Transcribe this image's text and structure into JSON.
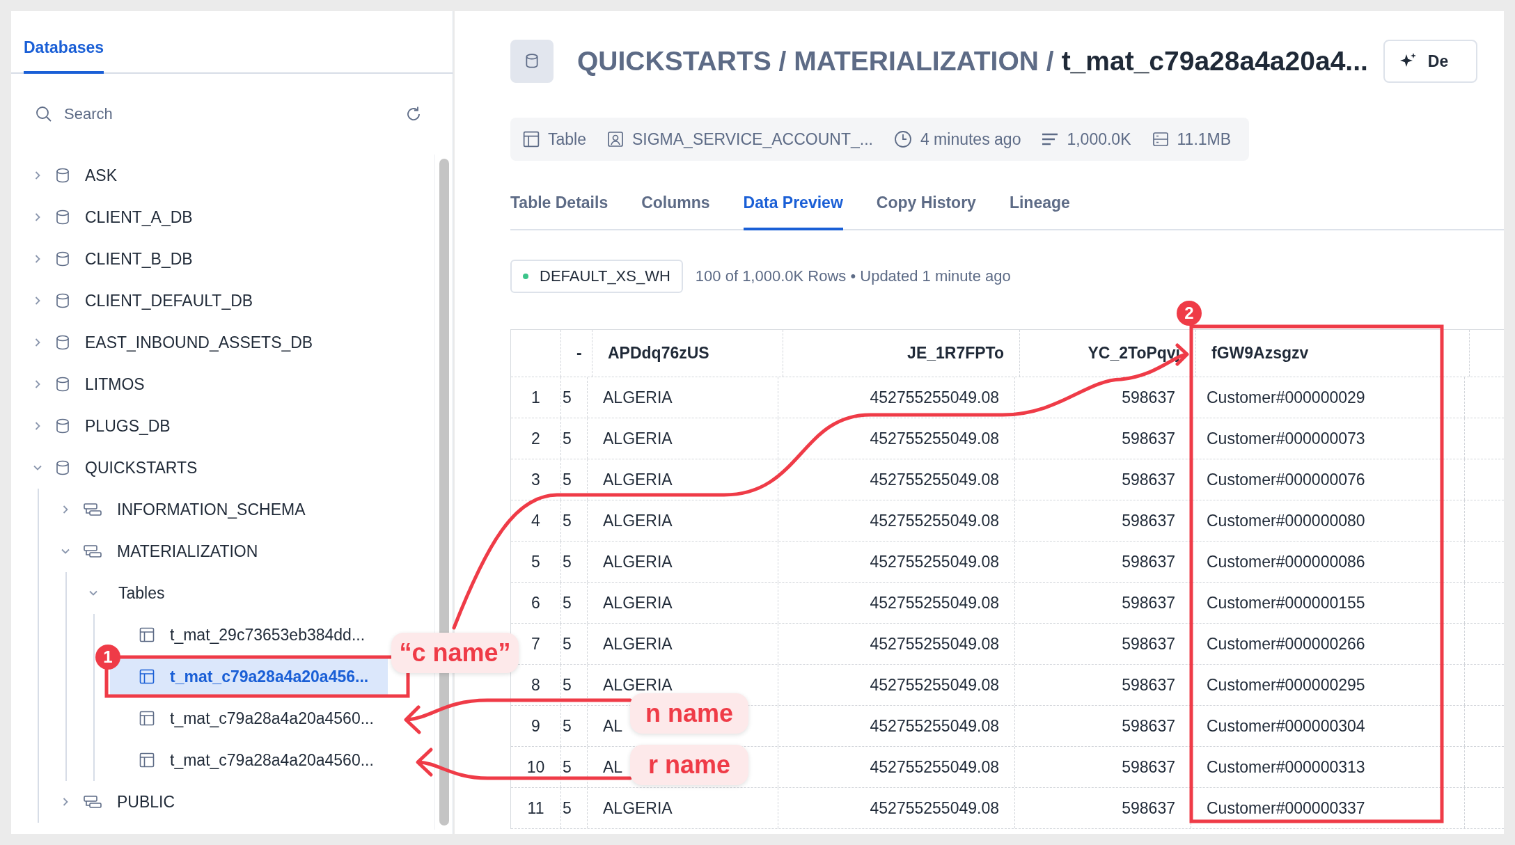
{
  "sidebar": {
    "tab": {
      "label": "Databases",
      "selected": true
    },
    "search": {
      "placeholder": "Search"
    },
    "tree": [
      {
        "kind": "database",
        "label": "ASK",
        "expanded": false,
        "selected": false
      },
      {
        "kind": "database",
        "label": "CLIENT_A_DB",
        "expanded": false,
        "selected": false
      },
      {
        "kind": "database",
        "label": "CLIENT_B_DB",
        "expanded": false,
        "selected": false
      },
      {
        "kind": "database",
        "label": "CLIENT_DEFAULT_DB",
        "expanded": false,
        "selected": false
      },
      {
        "kind": "database",
        "label": "EAST_INBOUND_ASSETS_DB",
        "expanded": false,
        "selected": false
      },
      {
        "kind": "database",
        "label": "LITMOS",
        "expanded": false,
        "selected": false
      },
      {
        "kind": "database",
        "label": "PLUGS_DB",
        "expanded": false,
        "selected": false
      },
      {
        "kind": "database",
        "label": "QUICKSTARTS",
        "expanded": true,
        "selected": false,
        "children": [
          {
            "kind": "schema",
            "label": "INFORMATION_SCHEMA",
            "expanded": false,
            "selected": false
          },
          {
            "kind": "schema",
            "label": "MATERIALIZATION",
            "expanded": true,
            "selected": false,
            "children": [
              {
                "kind": "folder",
                "label": "Tables",
                "expanded": true,
                "selected": false,
                "children": [
                  {
                    "kind": "table",
                    "label": "t_mat_29c73653eb384dd...",
                    "selected": false
                  },
                  {
                    "kind": "table",
                    "label": "t_mat_c79a28a4a20a456...",
                    "selected": true
                  },
                  {
                    "kind": "table",
                    "label": "t_mat_c79a28a4a20a4560...",
                    "selected": false
                  },
                  {
                    "kind": "table",
                    "label": "t_mat_c79a28a4a20a4560...",
                    "selected": false
                  }
                ]
              }
            ]
          },
          {
            "kind": "schema",
            "label": "PUBLIC",
            "expanded": false,
            "selected": false
          }
        ]
      }
    ]
  },
  "header": {
    "path": "QUICKSTARTS / MATERIALIZATION /",
    "title": "t_mat_c79a28a4a20a4...",
    "button": "De"
  },
  "meta": [
    {
      "kind": "type",
      "text": "Table"
    },
    {
      "kind": "owner",
      "text": "SIGMA_SERVICE_ACCOUNT_..."
    },
    {
      "kind": "time",
      "text": "4 minutes ago"
    },
    {
      "kind": "rows",
      "text": "1,000.0K"
    },
    {
      "kind": "size",
      "text": "11.1MB"
    }
  ],
  "tabs": [
    {
      "label": "Table Details",
      "selected": false
    },
    {
      "label": "Columns",
      "selected": false
    },
    {
      "label": "Data Preview",
      "selected": true
    },
    {
      "label": "Copy History",
      "selected": false
    },
    {
      "label": "Lineage",
      "selected": false
    }
  ],
  "warehouse": {
    "name": "DEFAULT_XS_WH",
    "color": "#3cc48a"
  },
  "status": "100 of 1,000.0K Rows • Updated 1 minute ago",
  "table": {
    "columns": [
      "",
      "-",
      "APDdq76zUS",
      "JE_1R7FPTo",
      "YC_2ToPqvj",
      "fGW9Azsgzv"
    ],
    "rows": [
      [
        "1",
        "5",
        "ALGERIA",
        "452755255049.08",
        "598637",
        "Customer#000000029"
      ],
      [
        "2",
        "5",
        "ALGERIA",
        "452755255049.08",
        "598637",
        "Customer#000000073"
      ],
      [
        "3",
        "5",
        "ALGERIA",
        "452755255049.08",
        "598637",
        "Customer#000000076"
      ],
      [
        "4",
        "5",
        "ALGERIA",
        "452755255049.08",
        "598637",
        "Customer#000000080"
      ],
      [
        "5",
        "5",
        "ALGERIA",
        "452755255049.08",
        "598637",
        "Customer#000000086"
      ],
      [
        "6",
        "5",
        "ALGERIA",
        "452755255049.08",
        "598637",
        "Customer#000000155"
      ],
      [
        "7",
        "5",
        "ALGERIA",
        "452755255049.08",
        "598637",
        "Customer#000000266"
      ],
      [
        "8",
        "5",
        "ALGERIA",
        "452755255049.08",
        "598637",
        "Customer#000000295"
      ],
      [
        "9",
        "5",
        "AL",
        "452755255049.08",
        "598637",
        "Customer#000000304"
      ],
      [
        "10",
        "5",
        "AL",
        "452755255049.08",
        "598637",
        "Customer#000000313"
      ],
      [
        "11",
        "5",
        "ALGERIA",
        "452755255049.08",
        "598637",
        "Customer#000000337"
      ]
    ]
  },
  "annotations": {
    "badges": [
      "1",
      "2"
    ],
    "labels": [
      "“c name”",
      "n name",
      "r name"
    ]
  }
}
